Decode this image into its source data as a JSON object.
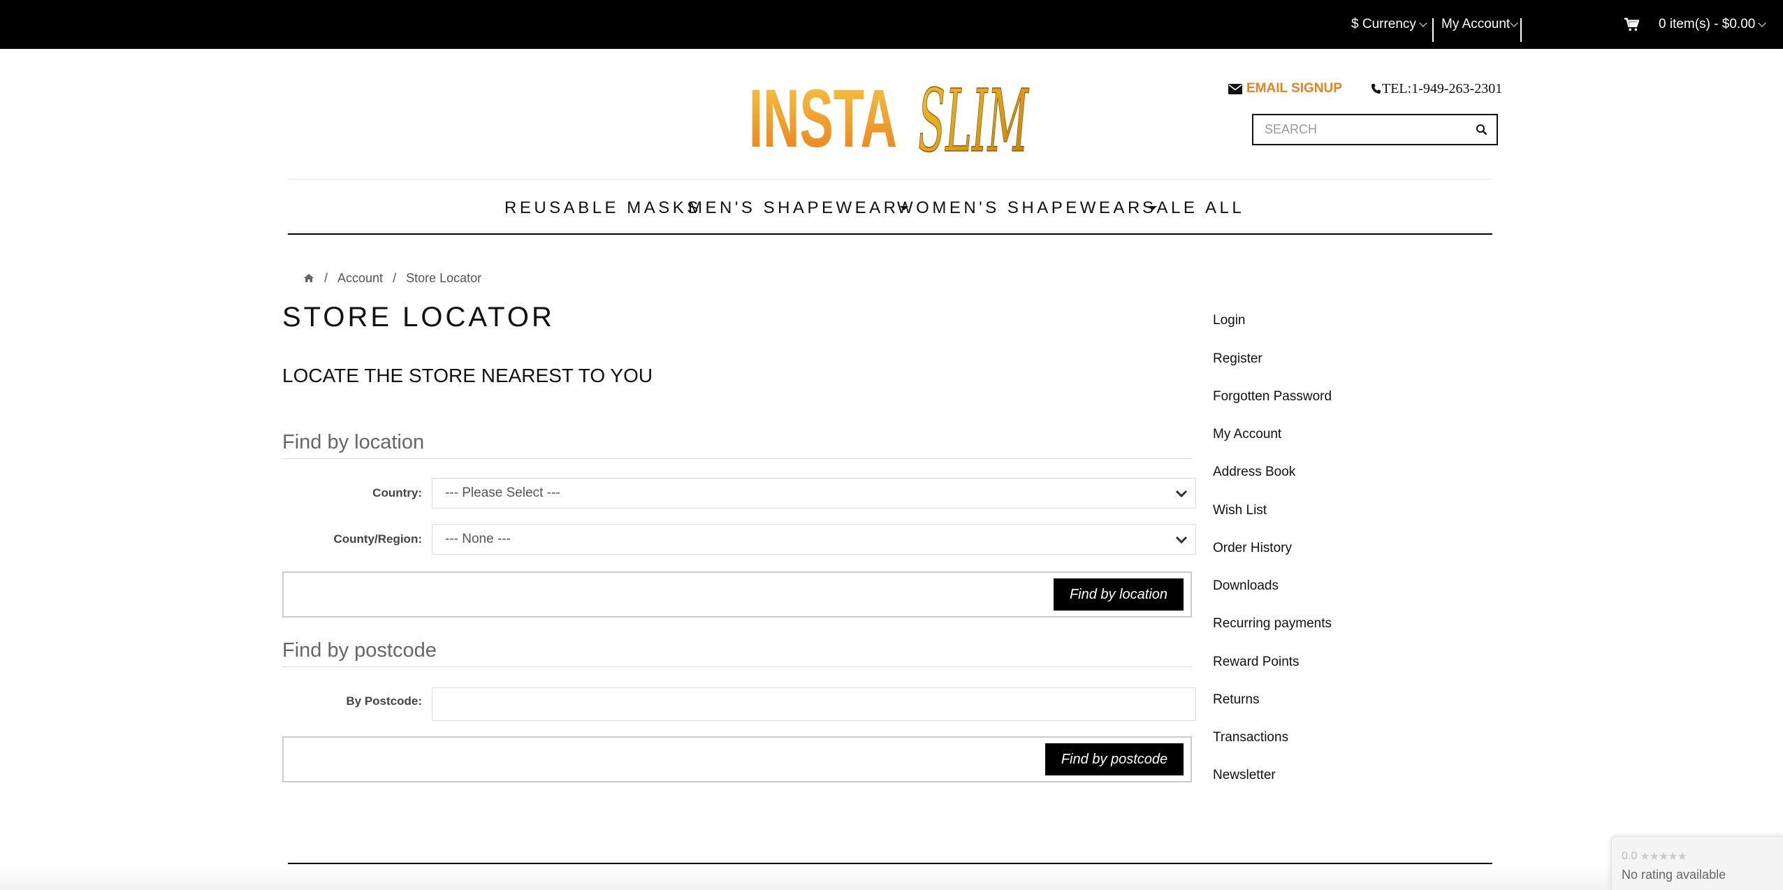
{
  "topbar": {
    "currency_label": "$ Currency",
    "account_label": "My Account",
    "cart_label": "0 item(s) - $0.00"
  },
  "header": {
    "logo_text_1": "INSTA",
    "logo_text_2": "SLIM",
    "email_signup": "EMAIL SIGNUP",
    "tel": "TEL:1-949-263-2301",
    "search_placeholder": "SEARCH"
  },
  "nav": {
    "items": [
      {
        "label": "REUSABLE MASKS"
      },
      {
        "label": "MEN'S SHAPEWEAR"
      },
      {
        "label": "WOMEN'S SHAPEWEAR"
      },
      {
        "label": "SALE"
      },
      {
        "label": "ALL"
      }
    ]
  },
  "breadcrumb": {
    "items": [
      "Account",
      "Store Locator"
    ]
  },
  "main": {
    "title": "STORE LOCATOR",
    "subtitle": "LOCATE THE STORE NEAREST TO YOU",
    "location_section": {
      "legend": "Find by location",
      "country_label": "Country:",
      "country_value": "--- Please Select ---",
      "region_label": "County/Region:",
      "region_value": "--- None ---",
      "button": "Find by location"
    },
    "postcode_section": {
      "legend": "Find by postcode",
      "postcode_label": "By Postcode:",
      "postcode_value": "",
      "button": "Find by postcode"
    }
  },
  "sidebar": {
    "links": [
      "Login",
      "Register",
      "Forgotten Password",
      "My Account",
      "Address Book",
      "Wish List",
      "Order History",
      "Downloads",
      "Recurring payments",
      "Reward Points",
      "Returns",
      "Transactions",
      "Newsletter"
    ]
  },
  "rating_badge": {
    "score": "0.0",
    "stars": "★★★★★",
    "text": "No rating available"
  },
  "colors": {
    "topbar_bg": "#000000",
    "accent_orange": "#e8821e",
    "logo_gold": "#f0a020",
    "button_bg": "#000000"
  }
}
